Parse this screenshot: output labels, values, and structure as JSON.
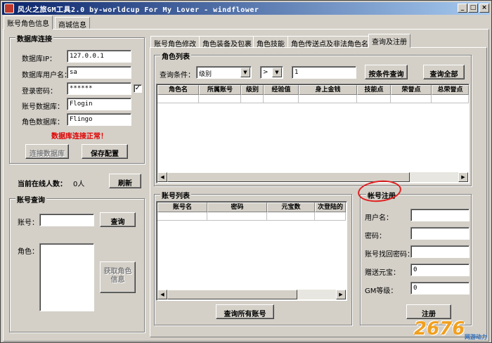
{
  "window": {
    "title": "风火之旅GM工具2.0  by-worldcup For My Lover - windflower",
    "min": "_",
    "max": "□",
    "close": "×"
  },
  "left_tabs": [
    "账号角色信息",
    "商城信息"
  ],
  "right_tabs": [
    "账号角色修改",
    "角色装备及包裹",
    "角色技能",
    "角色传送点及非法角色名",
    "查询及注册"
  ],
  "db": {
    "group_title": "数据库连接",
    "ip_label": "数据库IP：",
    "ip_value": "127.0.0.1",
    "user_label": "数据库用户名：",
    "user_value": "sa",
    "pass_label": "登录密码：",
    "pass_value": "******",
    "pass_checked": "✓",
    "acct_db_label": "账号数据库：",
    "acct_db_value": "Flogin",
    "role_db_label": "角色数据库：",
    "role_db_value": "Flingo",
    "status": "数据库连接正常！",
    "connect_btn": "连接数据库",
    "save_btn": "保存配置"
  },
  "online": {
    "label": "当前在线人数：",
    "count": "0人",
    "refresh_btn": "刷新"
  },
  "acct_query": {
    "group_title": "账号查询",
    "acct_label": "账号：",
    "query_btn": "查询",
    "role_label": "角色：",
    "get_role_btn": "获取角色信息"
  },
  "role_list": {
    "group_title": "角色列表",
    "cond_label": "查询条件：",
    "field_select": "级别",
    "op_select": ">",
    "value": "1",
    "query_cond_btn": "按条件查询",
    "query_all_btn": "查询全部",
    "columns": [
      "角色名",
      "所属账号",
      "级别",
      "经验值",
      "身上金钱",
      "技能点",
      "荣誉点",
      "总荣誉点"
    ]
  },
  "acct_list": {
    "group_title": "账号列表",
    "columns": [
      "账号名",
      "密码",
      "元宝数",
      "次登陆的"
    ],
    "query_all_btn": "查询所有账号"
  },
  "register": {
    "group_title": "帐号注册",
    "user_label": "用户名：",
    "pass_label": "密码：",
    "recover_label": "账号找回密码：",
    "gift_label": "赠送元宝：",
    "gift_value": "0",
    "gm_label": "GM等级：",
    "gm_value": "0",
    "submit_btn": "注册"
  },
  "watermark": {
    "text": "2676",
    "sub": "网游动力"
  }
}
